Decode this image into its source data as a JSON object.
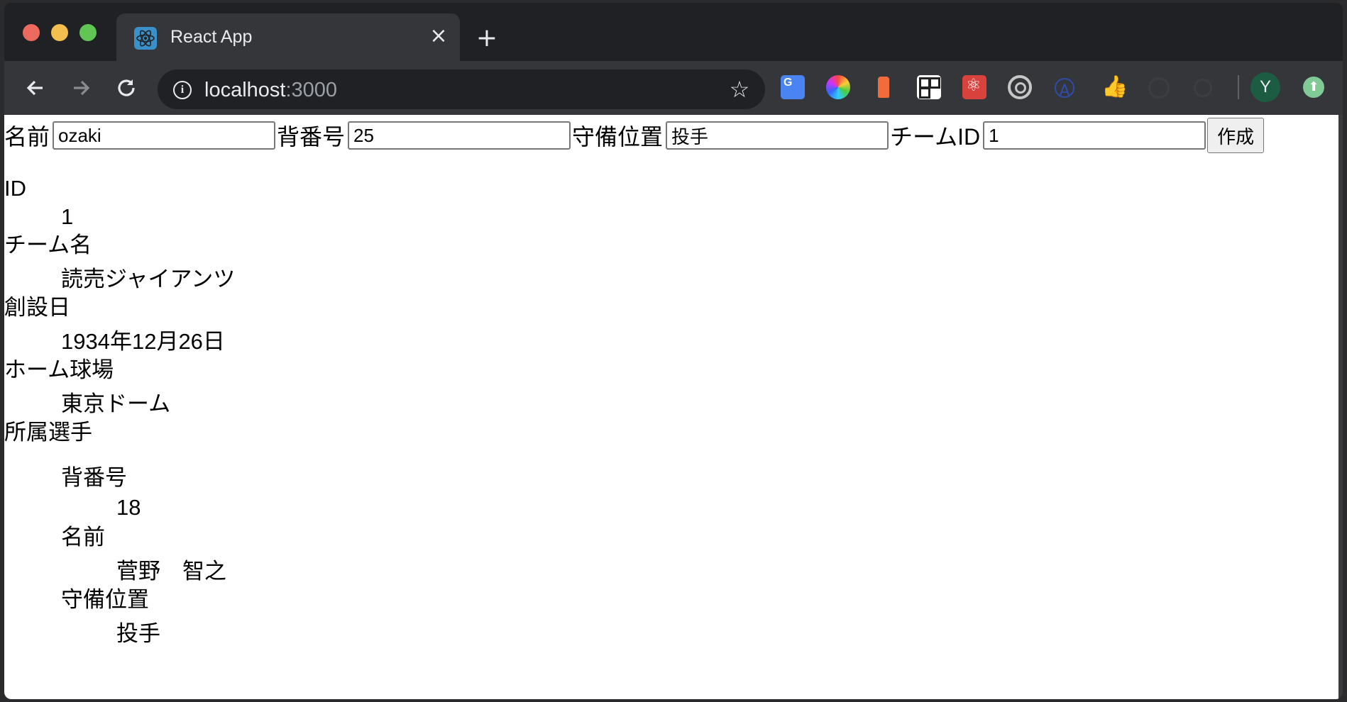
{
  "browser": {
    "tab_title": "React App",
    "tab_close": "×",
    "new_tab": "+",
    "url_host": "localhost",
    "url_port": ":3000",
    "avatar_letter": "Y"
  },
  "form": {
    "name_label": "名前",
    "name_value": "ozaki",
    "number_label": "背番号",
    "number_value": "25",
    "position_label": "守備位置",
    "position_value": "投手",
    "team_id_label": "チームID",
    "team_id_value": "1",
    "submit_label": "作成"
  },
  "team": {
    "id_label": "ID",
    "id_value": "1",
    "name_label": "チーム名",
    "name_value": "読売ジャイアンツ",
    "founded_label": "創設日",
    "founded_value": "1934年12月26日",
    "stadium_label": "ホーム球場",
    "stadium_value": "東京ドーム",
    "players_label": "所属選手"
  },
  "player": {
    "number_label": "背番号",
    "number_value": "18",
    "name_label": "名前",
    "name_value": "菅野　智之",
    "position_label": "守備位置",
    "position_value": "投手"
  }
}
